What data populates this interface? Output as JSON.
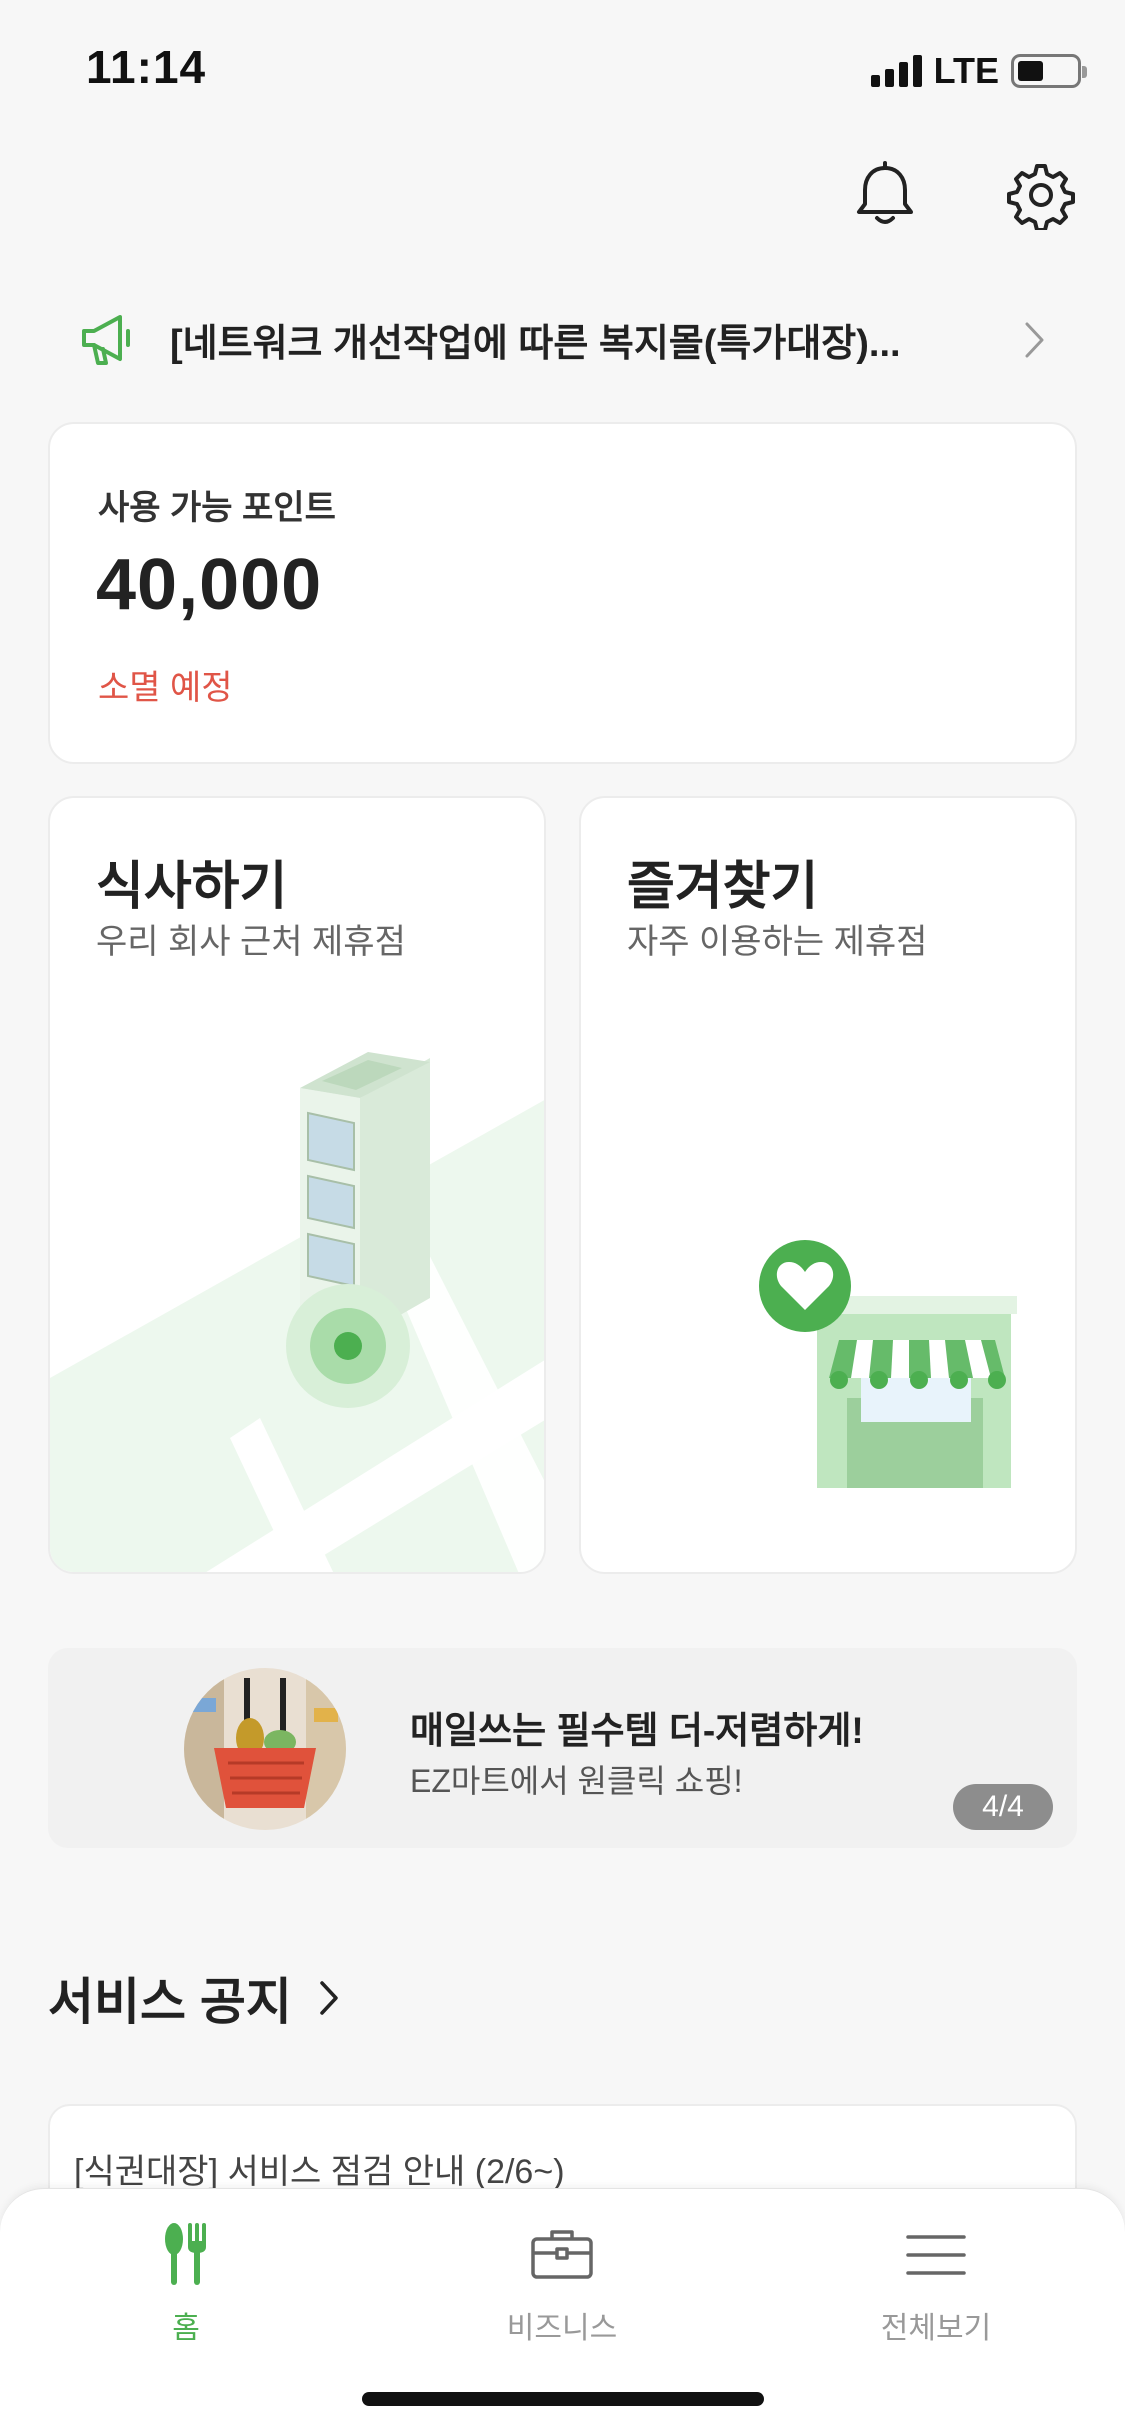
{
  "status_bar": {
    "time": "11:14",
    "network": "LTE"
  },
  "header": {
    "bell_icon": "bell-icon",
    "settings_icon": "gear-icon"
  },
  "notice_banner": {
    "icon": "megaphone-icon",
    "text": "[네트워크 개선작업에 따른 복지몰(특가대장)..."
  },
  "points": {
    "label": "사용 가능 포인트",
    "value": "40,000",
    "expire_label": "소멸 예정"
  },
  "tiles": {
    "eat": {
      "title": "식사하기",
      "subtitle": "우리 회사 근처 제휴점"
    },
    "favorites": {
      "title": "즐겨찾기",
      "subtitle": "자주 이용하는 제휴점"
    }
  },
  "promo": {
    "title": "매일쓰는 필수템 더-저렴하게!",
    "subtitle": "EZ마트에서 원클릭 쇼핑!",
    "pager": "4/4"
  },
  "service_notice": {
    "title": "서비스 공지",
    "items": [
      "[식권대장] 서비스 점검 안내 (2/6~)"
    ]
  },
  "tab_bar": {
    "tabs": [
      {
        "label": "홈",
        "icon": "fork-spoon-icon",
        "active": true
      },
      {
        "label": "비즈니스",
        "icon": "briefcase-icon",
        "active": false
      },
      {
        "label": "전체보기",
        "icon": "menu-icon",
        "active": false
      }
    ]
  },
  "colors": {
    "accent": "#4caf50",
    "warning": "#e05547",
    "background": "#f7f7f7"
  }
}
